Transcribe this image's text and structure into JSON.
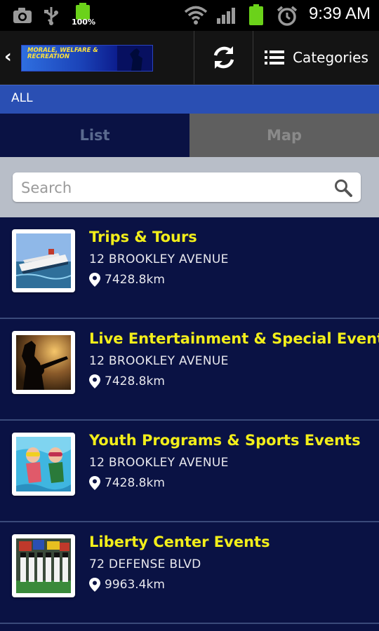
{
  "status_bar": {
    "battery_label": "100%",
    "time": "9:39 AM"
  },
  "action_bar": {
    "logo_text": "MORALE, WELFARE & RECREATION",
    "categories_label": "Categories"
  },
  "filter": {
    "label": "ALL"
  },
  "tabs": [
    {
      "label": "List",
      "active": true
    },
    {
      "label": "Map",
      "active": false
    }
  ],
  "search": {
    "placeholder": "Search",
    "value": ""
  },
  "items": [
    {
      "title": "Trips & Tours",
      "address": "12 BROOKLEY AVENUE",
      "distance": "7428.8km",
      "image": "cruise-ship"
    },
    {
      "title": "Live Entertainment & Special Events",
      "address": "12 BROOKLEY AVENUE",
      "distance": "7428.8km",
      "image": "guitarist-silhouette"
    },
    {
      "title": "Youth Programs & Sports Events",
      "address": "12 BROOKLEY AVENUE",
      "distance": "7428.8km",
      "image": "kids-swimming"
    },
    {
      "title": "Liberty Center Events",
      "address": "72 DEFENSE BLVD",
      "distance": "9963.4km",
      "image": "color-guard-parade"
    }
  ],
  "colors": {
    "background": "#0a1244",
    "title_yellow": "#f2ee1a",
    "filter_blue": "#2a4fb3"
  }
}
